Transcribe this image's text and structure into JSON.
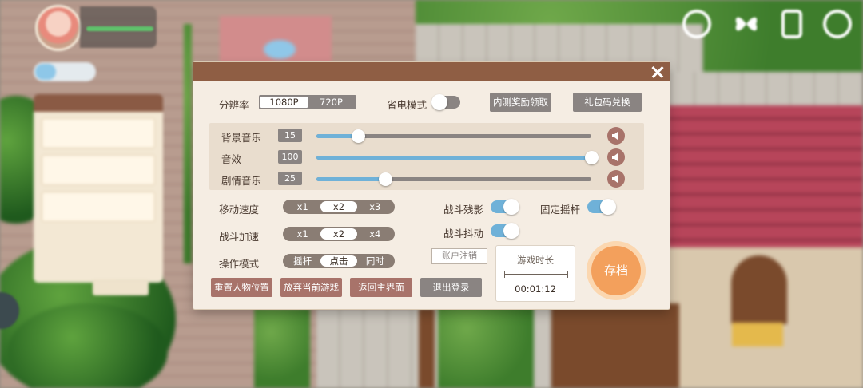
{
  "settings": {
    "resolution_label": "分辨率",
    "resolution_options": [
      "1080P",
      "720P"
    ],
    "power_saving_label": "省电模式",
    "power_saving_on": false,
    "beta_reward_button": "内测奖励领取",
    "gift_code_button": "礼包码兑换",
    "audio": [
      {
        "label": "背景音乐",
        "value": "15",
        "level": 15
      },
      {
        "label": "音效",
        "value": "100",
        "level": 100
      },
      {
        "label": "剧情音乐",
        "value": "25",
        "level": 25
      }
    ],
    "move_speed_label": "移动速度",
    "move_speed_options": [
      "x1",
      "x2",
      "x3"
    ],
    "move_speed_selected": "x2",
    "battle_speed_label": "战斗加速",
    "battle_speed_options": [
      "x1",
      "x2",
      "x4"
    ],
    "battle_speed_selected": "x2",
    "control_mode_label": "操作模式",
    "control_mode_options": [
      "摇杆",
      "点击",
      "同时"
    ],
    "control_mode_selected": "点击",
    "afterimage_label": "战斗残影",
    "afterimage_on": true,
    "fixed_joystick_label": "固定摇杆",
    "fixed_joystick_on": true,
    "shake_label": "战斗抖动",
    "shake_on": true,
    "logout_account_button": "账户注销",
    "playtime_label": "游戏时长",
    "playtime_value": "00:01:12",
    "save_button": "存档",
    "reset_position_button": "重置人物位置",
    "abandon_game_button": "放弃当前游戏",
    "main_menu_button": "返回主界面",
    "logout_button": "退出登录"
  },
  "colors": {
    "header": "#8f5e44",
    "panel": "#f5ede3",
    "accent_blue": "#6fb1d8",
    "brown_button": "#a8736a",
    "grey": "#8a8482",
    "save_orange": "#f3a05c"
  }
}
